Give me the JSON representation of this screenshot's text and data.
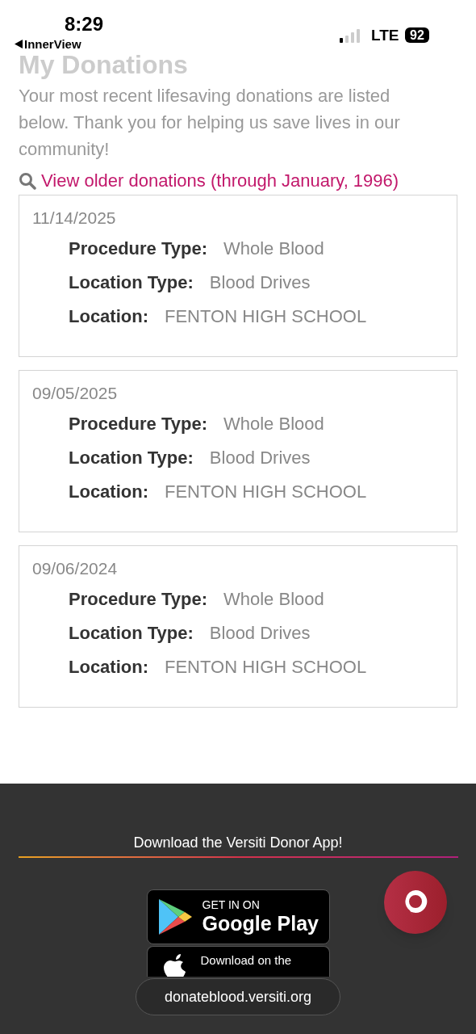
{
  "status_bar": {
    "time": "8:29",
    "back_label": "InnerView",
    "network": "LTE",
    "battery": "92"
  },
  "page": {
    "title": "My Donations",
    "intro": "Your most recent lifesaving donations are listed below. Thank you for helping us save lives in our community!",
    "older_link": "View older donations (through January, 1996)"
  },
  "donations": [
    {
      "date": "11/14/2025",
      "fields": [
        {
          "label": "Procedure Type:",
          "value": "Whole Blood"
        },
        {
          "label": "Location Type:",
          "value": "Blood Drives"
        },
        {
          "label": "Location:",
          "value": "FENTON HIGH SCHOOL"
        }
      ]
    },
    {
      "date": "09/05/2025",
      "fields": [
        {
          "label": "Procedure Type:",
          "value": "Whole Blood"
        },
        {
          "label": "Location Type:",
          "value": "Blood Drives"
        },
        {
          "label": "Location:",
          "value": "FENTON HIGH SCHOOL"
        }
      ]
    },
    {
      "date": "09/06/2024",
      "fields": [
        {
          "label": "Procedure Type:",
          "value": "Whole Blood"
        },
        {
          "label": "Location Type:",
          "value": "Blood Drives"
        },
        {
          "label": "Location:",
          "value": "FENTON HIGH SCHOOL"
        }
      ]
    }
  ],
  "footer": {
    "heading": "Download the Versiti Donor App!",
    "google_play": {
      "small": "GET IN ON",
      "large": "Google Play"
    },
    "app_store": {
      "small": "Download on the"
    },
    "url": "donateblood.versiti.org"
  }
}
